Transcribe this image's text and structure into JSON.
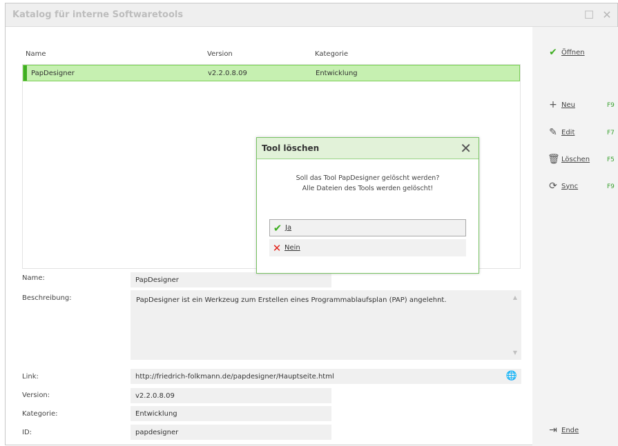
{
  "window": {
    "title": "Katalog für interne Softwaretools"
  },
  "list": {
    "columns": [
      "Name",
      "Version",
      "Kategorie"
    ],
    "rows": [
      {
        "name": "PapDesigner",
        "version": "v2.2.0.8.09",
        "kategorie": "Entwicklung"
      }
    ]
  },
  "fields": {
    "name_label": "Name:",
    "name_value": "PapDesigner",
    "beschreibung_label": "Beschreibung:",
    "beschreibung_value": "PapDesigner ist ein Werkzeug zum Erstellen eines Programmablaufsplan (PAP) angelehnt.",
    "link_label": "Link:",
    "link_value": "http://friedrich-folkmann.de/papdesigner/Hauptseite.html",
    "version_label": "Version:",
    "version_value": "v2.2.0.8.09",
    "kategorie_label": "Kategorie:",
    "kategorie_value": "Entwicklung",
    "id_label": "ID:",
    "id_value": "papdesigner"
  },
  "sidebar": {
    "oeffnen": "Öffnen",
    "neu": "Neu",
    "neu_key": "F9",
    "edit": "Edit",
    "edit_key": "F7",
    "loeschen": "Löschen",
    "loeschen_key": "F5",
    "sync": "Sync",
    "sync_key": "F9",
    "ende": "Ende"
  },
  "dialog": {
    "title": "Tool löschen",
    "message_line1": "Soll das Tool PapDesigner gelöscht werden?",
    "message_line2": "Alle Dateien des Tools werden gelöscht!",
    "yes": "Ja",
    "no": "Nein"
  },
  "colors": {
    "accent_green": "#3fae22",
    "selection": "#c6f0b1",
    "danger_red": "#e2231a"
  }
}
